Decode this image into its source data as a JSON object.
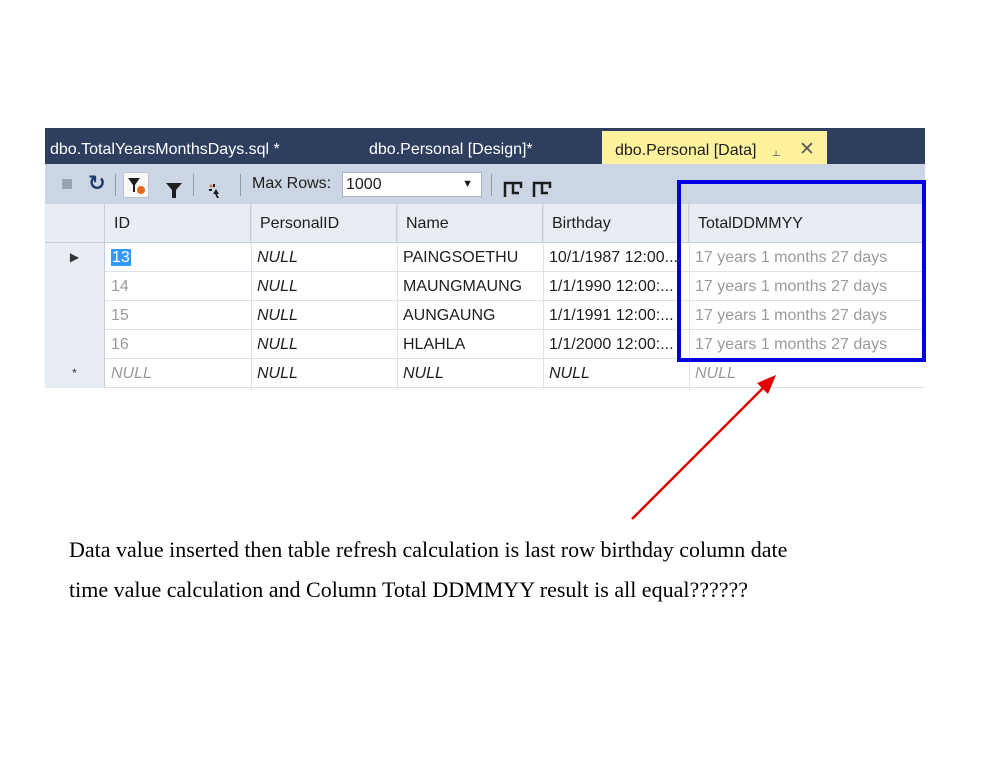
{
  "tabs": [
    {
      "label": "dbo.TotalYearsMonthsDays.sql *",
      "active": false
    },
    {
      "label": "dbo.Personal [Design]*",
      "active": false
    },
    {
      "label": "dbo.Personal [Data]",
      "active": true
    }
  ],
  "active_tab_icons": [
    "pin-icon",
    "close-icon"
  ],
  "toolbar": {
    "buttons": [
      "stop-icon",
      "refresh-icon",
      "filter-clear-icon",
      "filter-icon",
      "sql-script-icon",
      "include-actual-plan-icon",
      "exclude-plan-icon"
    ],
    "max_rows_label": "Max Rows:",
    "max_rows_value": "1000"
  },
  "grid": {
    "columns": [
      "ID",
      "PersonalID",
      "Name",
      "Birthday",
      "TotalDDMMYY"
    ],
    "rows": [
      {
        "indicator": "▶",
        "id": "13",
        "personal_id": "NULL",
        "name": "PAINGSOETHU",
        "birthday": "10/1/1987 12:00...",
        "total": "17 years 1 months 27 days"
      },
      {
        "indicator": "",
        "id": "14",
        "personal_id": "NULL",
        "name": "MAUNGMAUNG",
        "birthday": "1/1/1990 12:00:...",
        "total": "17 years 1 months 27 days"
      },
      {
        "indicator": "",
        "id": "15",
        "personal_id": "NULL",
        "name": "AUNGAUNG",
        "birthday": "1/1/1991 12:00:...",
        "total": "17 years 1 months 27 days"
      },
      {
        "indicator": "",
        "id": "16",
        "personal_id": "NULL",
        "name": "HLAHLA",
        "birthday": "1/1/2000 12:00:...",
        "total": "17 years 1 months 27 days"
      },
      {
        "indicator": "*",
        "id": "NULL",
        "personal_id": "NULL",
        "name": "NULL",
        "birthday": "NULL",
        "total": "NULL"
      }
    ]
  },
  "annotation": {
    "box_color": "#0000e0",
    "arrow_color": "#e00000",
    "caption_line1": "Data value inserted then table refresh calculation is last row birthday column date",
    "caption_line2": "time value calculation and  Column Total DDMMYY result is all equal??????"
  }
}
